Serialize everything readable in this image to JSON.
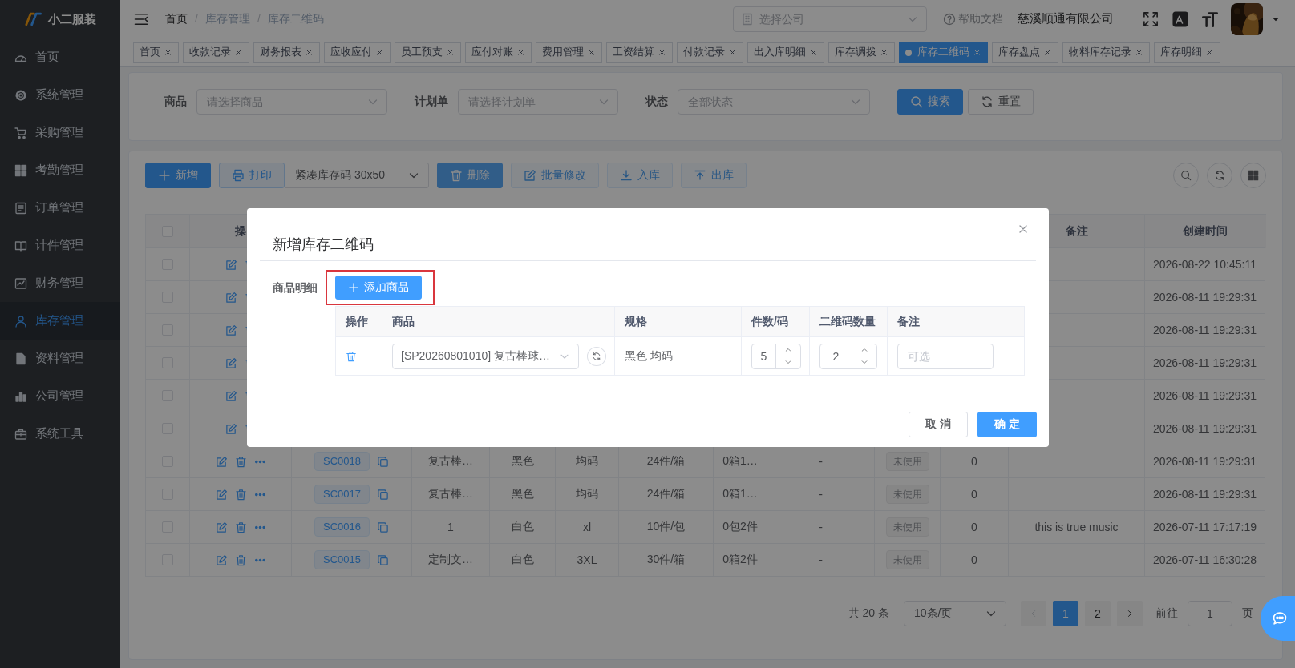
{
  "sidebar": {
    "logo": "小二服装",
    "items": [
      {
        "label": "首页",
        "selected": false
      },
      {
        "label": "系统管理",
        "selected": false
      },
      {
        "label": "采购管理",
        "selected": false
      },
      {
        "label": "考勤管理",
        "selected": false
      },
      {
        "label": "订单管理",
        "selected": false
      },
      {
        "label": "计件管理",
        "selected": false
      },
      {
        "label": "财务管理",
        "selected": false
      },
      {
        "label": "库存管理",
        "selected": true
      },
      {
        "label": "资料管理",
        "selected": false
      },
      {
        "label": "公司管理",
        "selected": false
      },
      {
        "label": "系统工具",
        "selected": false
      }
    ]
  },
  "header": {
    "breadcrumbs": [
      {
        "kind": "link",
        "text": "首页"
      },
      {
        "kind": "separator",
        "text": "/"
      },
      {
        "kind": "crumb",
        "text": "库存管理"
      },
      {
        "kind": "separator",
        "text": "/"
      },
      {
        "kind": "crumb",
        "text": "库存二维码"
      }
    ],
    "company_select": {
      "placeholder": "选择公司"
    },
    "help_link": "帮助文档",
    "company_name": "慈溪顺通有限公司"
  },
  "tags": [
    {
      "label": "首页",
      "selected": false
    },
    {
      "label": "收款记录",
      "selected": false
    },
    {
      "label": "财务报表",
      "selected": false
    },
    {
      "label": "应收应付",
      "selected": false
    },
    {
      "label": "员工预支",
      "selected": false
    },
    {
      "label": "应付对账",
      "selected": false
    },
    {
      "label": "费用管理",
      "selected": false
    },
    {
      "label": "工资结算",
      "selected": false
    },
    {
      "label": "付款记录",
      "selected": false
    },
    {
      "label": "出入库明细",
      "selected": false
    },
    {
      "label": "库存调拨",
      "selected": false
    },
    {
      "label": "库存二维码",
      "selected": true
    },
    {
      "label": "库存盘点",
      "selected": false
    },
    {
      "label": "物料库存记录",
      "selected": false
    },
    {
      "label": "库存明细",
      "selected": false
    }
  ],
  "filters": [
    {
      "label": "商品",
      "placeholder": "请选择商品"
    },
    {
      "label": "计划单",
      "placeholder": "请选择计划单"
    },
    {
      "label": "状态",
      "placeholder": "全部状态"
    }
  ],
  "search_button": "搜索",
  "reset_button": "重置",
  "toolbar": [
    {
      "kind": "primary",
      "label": "新增",
      "disabled": false
    },
    {
      "kind": "plain",
      "label": "打印",
      "disabled": false
    },
    {
      "kind": "select",
      "value": "紧凑库存码 30x50"
    },
    {
      "kind": "primary",
      "label": "删除",
      "disabled": true
    },
    {
      "kind": "plain",
      "label": "批量修改",
      "disabled": true
    },
    {
      "kind": "plain",
      "label": "入库",
      "disabled": true
    },
    {
      "kind": "plain",
      "label": "出库",
      "disabled": true
    }
  ],
  "table": {
    "header": {
      "checked": false,
      "actions": "操",
      "remark": "备注",
      "created": "创建时间"
    },
    "rows": [
      {
        "checked": false,
        "created": "2026-08-22 10:45:11"
      },
      {
        "checked": false,
        "created": "2026-08-11 19:29:31"
      },
      {
        "checked": false,
        "created": "2026-08-11 19:29:31"
      },
      {
        "checked": false,
        "created": "2026-08-11 19:29:31"
      },
      {
        "checked": false,
        "created": "2026-08-11 19:29:31"
      },
      {
        "checked": false,
        "created": "2026-08-11 19:29:31"
      },
      {
        "checked": false,
        "code": "SC0018",
        "column_4": "复古棒…",
        "column_5": "黑色",
        "column_6": "均码",
        "column_7": "24件/箱",
        "column_8": "0箱1…",
        "column_9": "-",
        "status": "未使用",
        "column_11": "0",
        "created": "2026-08-11 19:29:31"
      },
      {
        "checked": false,
        "code": "SC0017",
        "column_4": "复古棒…",
        "column_5": "黑色",
        "column_6": "均码",
        "column_7": "24件/箱",
        "column_8": "0箱1…",
        "column_9": "-",
        "status": "未使用",
        "column_11": "0",
        "created": "2026-08-11 19:29:31"
      },
      {
        "checked": false,
        "code": "SC0016",
        "column_4": "1",
        "column_5": "白色",
        "column_6": "xl",
        "column_7": "10件/包",
        "column_8": "0包2件",
        "column_9": "-",
        "status": "未使用",
        "column_11": "0",
        "remark": "this is true music",
        "created": "2026-07-11 17:17:19"
      },
      {
        "checked": false,
        "code": "SC0015",
        "column_4": "定制文…",
        "column_5": "白色",
        "column_6": "3XL",
        "column_7": "30件/箱",
        "column_8": "0箱2件",
        "column_9": "-",
        "status": "未使用",
        "column_11": "0",
        "created": "2026-07-11 16:30:28"
      }
    ]
  },
  "pagination": {
    "total": "共 20 条",
    "page_size": "10条/页",
    "pages": [
      {
        "label": "1",
        "selected": true
      },
      {
        "label": "2",
        "selected": false
      }
    ],
    "jump_label": "前往",
    "jump_value": "1",
    "page_suffix": "页"
  },
  "dialog": {
    "title": "新增库存二维码",
    "field_label": "商品明细",
    "add_button": "添加商品",
    "highlighted": true,
    "columns": [
      "操作",
      "商品",
      "规格",
      "件数/码",
      "二维码数量",
      "备注"
    ],
    "rows": [
      {
        "product": "[SP20260801010] 复古棒球…",
        "spec": "黑色 均码",
        "pieces_per_code": "5",
        "qr_count": "2",
        "remark_placeholder": "可选"
      }
    ],
    "cancel_button": "取消",
    "confirm_button": "确定"
  }
}
